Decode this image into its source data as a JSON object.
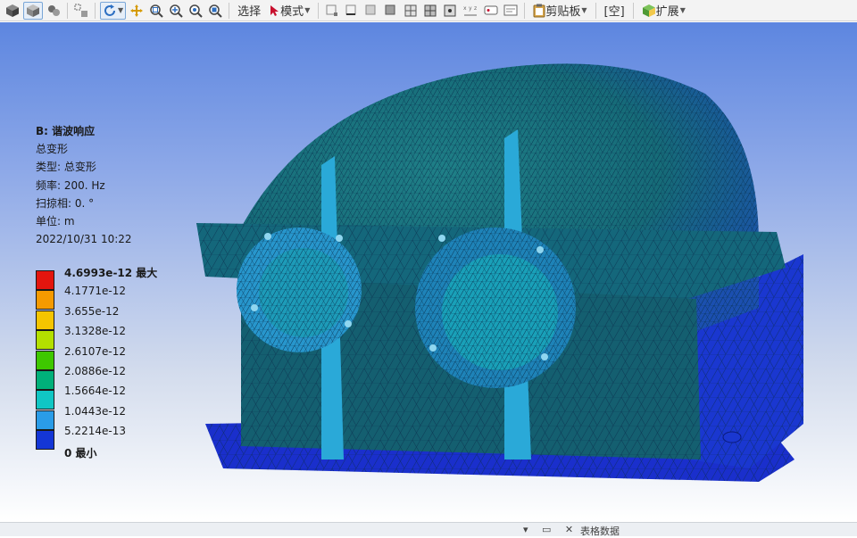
{
  "toolbar": {
    "icons": [
      "cube-solid-icon",
      "cube-shaded-icon",
      "cube-group-icon",
      "box-select-icon",
      "rotate-icon",
      "pan-icon",
      "zoom-fit-icon",
      "zoom-in-icon",
      "zoom-box-icon",
      "zoom-out-icon"
    ],
    "select_label": "选择",
    "mode_label": "模式",
    "clipboard_label": "剪贴板",
    "empty_label": "[空]",
    "extend_label": "扩展"
  },
  "result": {
    "title": "B: 谐波响应",
    "quantity": "总变形",
    "type": "类型: 总变形",
    "frequency": "频率: 200.   Hz",
    "sweep_phase": "扫掠相: 0. °",
    "unit": "单位: m",
    "timestamp": "2022/10/31 10:22"
  },
  "legend": {
    "levels": [
      {
        "label": "4.6993e-12 最大",
        "color": "#e3150e",
        "bold": true
      },
      {
        "label": "4.1771e-12",
        "color": "#f59a00"
      },
      {
        "label": "3.655e-12",
        "color": "#f5c500"
      },
      {
        "label": "3.1328e-12",
        "color": "#b4e000"
      },
      {
        "label": "2.6107e-12",
        "color": "#3ec800"
      },
      {
        "label": "2.0886e-12",
        "color": "#00b07a"
      },
      {
        "label": "1.5664e-12",
        "color": "#10c6c4"
      },
      {
        "label": "1.0443e-12",
        "color": "#2a9ce8"
      },
      {
        "label": "5.2214e-13",
        "color": "#1436d6"
      },
      {
        "label": "0 最小",
        "color": "#1436d6",
        "bold": true
      }
    ]
  },
  "statusbar": {
    "right_text": "表格数据"
  }
}
